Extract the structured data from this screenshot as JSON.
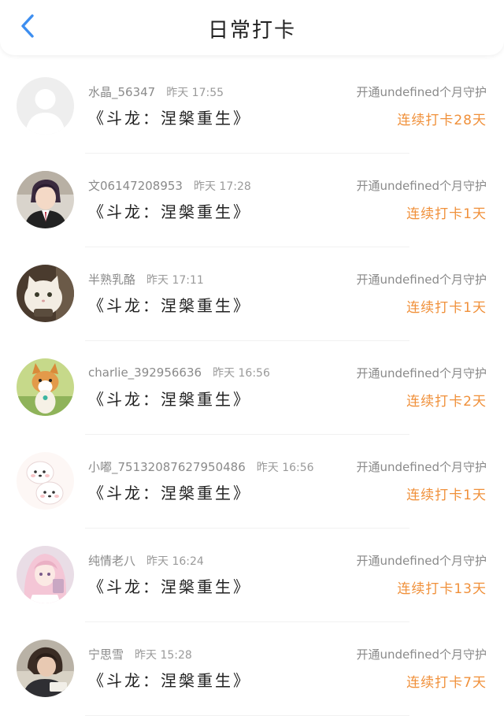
{
  "header": {
    "title": "日常打卡",
    "back_icon": "chevron-left-icon",
    "accent_color": "#3d8ef0"
  },
  "theme": {
    "streak_color": "#f0903a"
  },
  "entries": [
    {
      "user": "水晶_56347",
      "time": "昨天 17:55",
      "book": "《斗龙：涅槃重生》",
      "guard": "开通undefined个月守护",
      "streak": "连续打卡28天",
      "avatar": "default-avatar"
    },
    {
      "user": "文06147208953",
      "time": "昨天 17:28",
      "book": "《斗龙：涅槃重生》",
      "guard": "开通undefined个月守护",
      "streak": "连续打卡1天",
      "avatar": "anime-boy-avatar"
    },
    {
      "user": "半熟乳酪",
      "time": "昨天 17:11",
      "book": "《斗龙：涅槃重生》",
      "guard": "开通undefined个月守护",
      "streak": "连续打卡1天",
      "avatar": "cat-avatar"
    },
    {
      "user": "charlie_392956636",
      "time": "昨天 16:56",
      "book": "《斗龙：涅槃重生》",
      "guard": "开通undefined个月守护",
      "streak": "连续打卡2天",
      "avatar": "corgi-avatar"
    },
    {
      "user": "小嘟_75132087627950486",
      "time": "昨天 16:56",
      "book": "《斗龙：涅槃重生》",
      "guard": "开通undefined个月守护",
      "streak": "连续打卡1天",
      "avatar": "white-dogs-avatar"
    },
    {
      "user": "纯情老八",
      "time": "昨天 16:24",
      "book": "《斗龙：涅槃重生》",
      "guard": "开通undefined个月守护",
      "streak": "连续打卡13天",
      "avatar": "pink-anime-girl-avatar"
    },
    {
      "user": "宁思雪",
      "time": "昨天 15:28",
      "book": "《斗龙：涅槃重生》",
      "guard": "开通undefined个月守护",
      "streak": "连续打卡7天",
      "avatar": "girl-photo-avatar"
    }
  ]
}
